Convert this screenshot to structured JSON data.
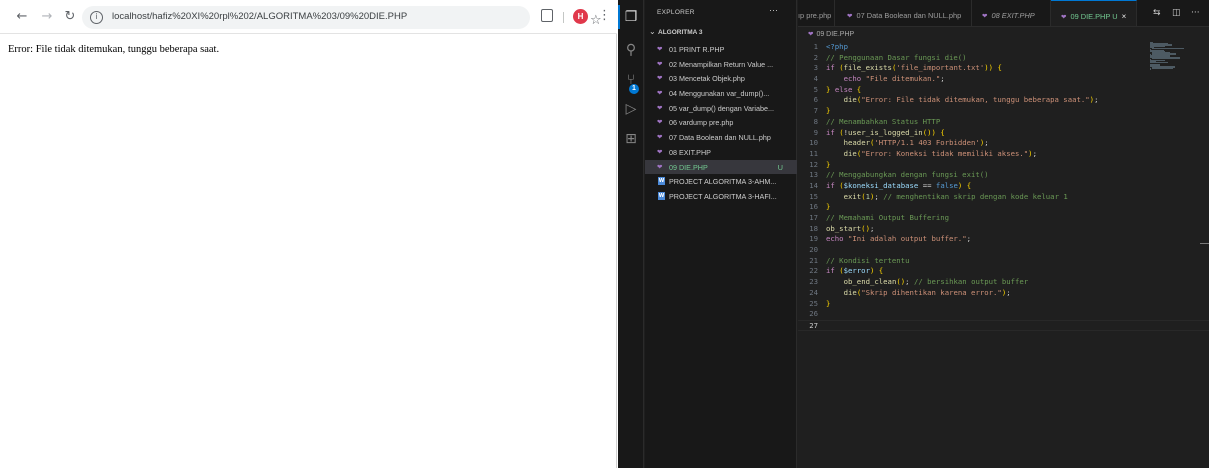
{
  "browser": {
    "url": "localhost/hafiz%20XI%20rpl%202/ALGORITMA%203/09%20DIE.PHP",
    "profile_initial": "H",
    "page_text": "Error: File tidak ditemukan, tunggu beberapa saat."
  },
  "vscode": {
    "explorer_title": "EXPLORER",
    "more_label": "···",
    "folder_name": "ALGORITMA 3",
    "scm_badge": "1",
    "files": [
      {
        "name": "01 PRINT R.PHP",
        "icon": "php-icon"
      },
      {
        "name": "02 Menampilkan Return Value ...",
        "icon": "php-icon"
      },
      {
        "name": "03 Mencetak Objek.php",
        "icon": "php-icon"
      },
      {
        "name": "04 Menggunakan var_dump()...",
        "icon": "php-icon"
      },
      {
        "name": "05 var_dump() dengan Variabe...",
        "icon": "php-icon"
      },
      {
        "name": "06 vardump pre.php",
        "icon": "php-icon"
      },
      {
        "name": "07 Data Boolean dan NULL.php",
        "icon": "php-icon"
      },
      {
        "name": "08 EXIT.PHP",
        "icon": "php-icon"
      },
      {
        "name": "09 DIE.PHP",
        "icon": "php-icon",
        "badge": "U",
        "active": true
      },
      {
        "name": "PROJECT ALGORITMA 3-AHM...",
        "icon": "word-doc-icon"
      },
      {
        "name": "PROJECT ALGORITMA 3-HAFI...",
        "icon": "word-doc-icon"
      }
    ],
    "tabs": [
      {
        "label": "ıp pre.php"
      },
      {
        "label": "07 Data Boolean dan NULL.php"
      },
      {
        "label": "08 EXIT.PHP"
      },
      {
        "label": "09 DIE.PHP U",
        "close": "×"
      }
    ],
    "breadcrumb": "09 DIE.PHP",
    "code_lines": [
      "<?php",
      "// Penggunaan Dasar fungsi die()",
      "if (file_exists('file_important.txt')) {",
      "    echo \"File ditemukan.\";",
      "} else {",
      "    die(\"Error: File tidak ditemukan, tunggu beberapa saat.\");",
      "}",
      "// Menambahkan Status HTTP",
      "if (!user_is_logged_in()) {",
      "    header('HTTP/1.1 403 Forbidden');",
      "    die(\"Error: Koneksi tidak memiliki akses.\");",
      "}",
      "// Menggabungkan dengan fungsi exit()",
      "if ($koneksi_database == false) {",
      "    exit(1); // menghentikan skrip dengan kode keluar 1",
      "}",
      "// Memahami Output Buffering",
      "ob_start();",
      "echo \"Ini adalah output buffer.\";",
      "",
      "// Kondisi tertentu",
      "if ($error) {",
      "    ob_end_clean(); // bersihkan output buffer",
      "    die(\"Skrip dihentikan karena error.\");",
      "}",
      "",
      ""
    ]
  },
  "colors": {
    "vscode_bg": "#1f1f1f",
    "sidebar_bg": "#181818",
    "accent": "#0078d4",
    "untracked_green": "#73c991",
    "php_icon": "#a074c4",
    "avatar": "#e0384b"
  }
}
